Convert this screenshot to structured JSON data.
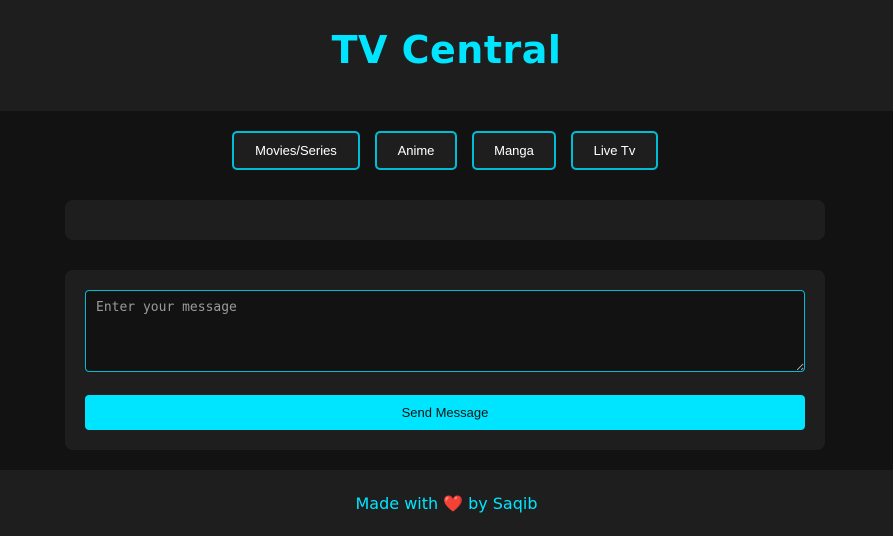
{
  "header": {
    "title": "TV Central"
  },
  "nav": {
    "items": [
      {
        "label": "Movies/Series"
      },
      {
        "label": "Anime"
      },
      {
        "label": "Manga"
      },
      {
        "label": "Live Tv"
      }
    ]
  },
  "message": {
    "placeholder": "Enter your message",
    "value": "",
    "send_label": "Send Message"
  },
  "footer": {
    "prefix": "Made with",
    "heart": "❤️",
    "suffix": "by Saqib"
  },
  "colors": {
    "accent": "#00e5ff",
    "border": "#00bcd4",
    "panel": "#1e1e1e",
    "background": "#121212",
    "heart": "#e53935"
  }
}
